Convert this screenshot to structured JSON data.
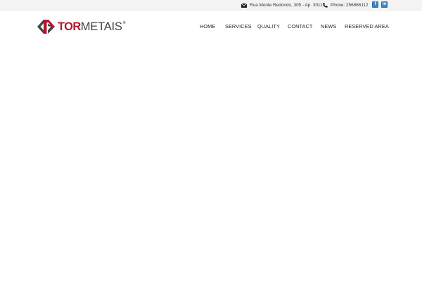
{
  "topbar": {
    "address": "Rua Monte Redondo, 305 - Ap. 3011",
    "phone": "Phone: 256866112",
    "address_icon": "envelope-icon",
    "phone_icon": "phone-icon",
    "social": [
      {
        "icon": "social-icon",
        "glyph": "f"
      },
      {
        "icon": "social-icon",
        "glyph": "in"
      }
    ]
  },
  "logo": {
    "part1": "TOR",
    "part2": "METAIS",
    "registered": "®",
    "colors": {
      "accent": "#b3182a",
      "dark": "#444444"
    }
  },
  "nav": {
    "items": [
      {
        "label": "HOME"
      },
      {
        "label": "SERVICES"
      },
      {
        "label": "QUALITY"
      },
      {
        "label": "CONTACT"
      },
      {
        "label": "NEWS"
      },
      {
        "label": "RESERVED AREA"
      }
    ]
  },
  "colors": {
    "topbar_bg": "#f3f3f3",
    "social_bg": "#3d85c6"
  }
}
